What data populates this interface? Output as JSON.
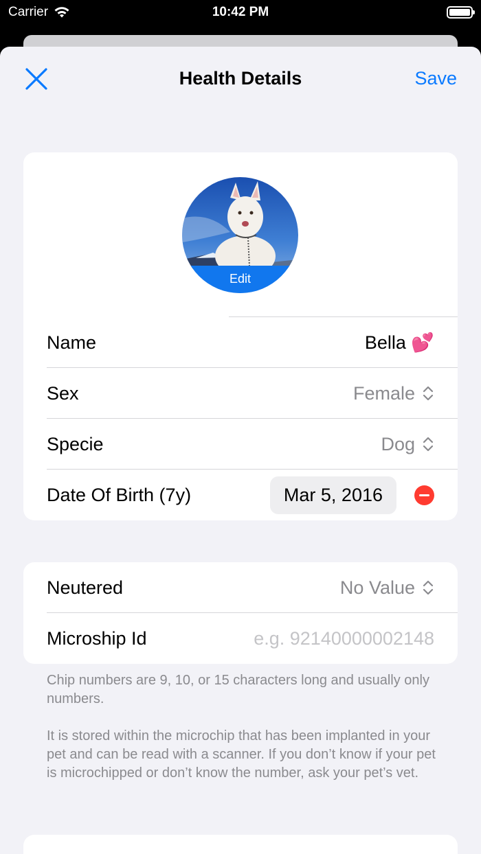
{
  "status_bar": {
    "carrier": "Carrier",
    "time": "10:42 PM",
    "icons": [
      "wifi-icon",
      "battery-icon"
    ]
  },
  "nav": {
    "close_icon": "close-icon",
    "title": "Health Details",
    "save_label": "Save",
    "accent_color": "#0a7aff"
  },
  "profile": {
    "avatar_edit_label": "Edit"
  },
  "details": {
    "name": {
      "label": "Name",
      "value": "Bella 💕"
    },
    "sex": {
      "label": "Sex",
      "value": "Female"
    },
    "specie": {
      "label": "Specie",
      "value": "Dog"
    },
    "dob": {
      "label": "Date Of Birth (7y)",
      "value": "Mar 5, 2016",
      "remove_icon": "minus-circle-icon",
      "remove_color": "#ff3b30"
    }
  },
  "chip": {
    "neutered": {
      "label": "Neutered",
      "value": "No Value"
    },
    "microchip": {
      "label": "Microship Id",
      "placeholder": "e.g. 92140000002148"
    }
  },
  "footnote": {
    "line1": "Chip numbers are 9, 10, or 15 characters long and usually only numbers.",
    "line2": "It is stored within the microchip that has been implanted in your pet and can be read with a scanner. If you don’t know if your pet is microchipped or don’t know the number, ask your pet’s vet."
  }
}
